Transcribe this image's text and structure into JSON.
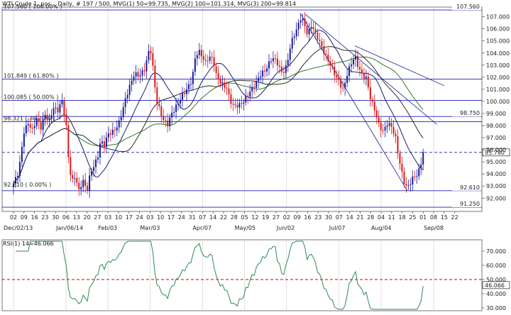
{
  "header": "WTI Crude 1. pos. , Daily, # 197 / 500, MVG(1) 50=99.735, MVG(2) 100=101.314, MVG(3) 200=99.814",
  "rsi_header": "RSI(1) 14=46.066",
  "chart_data": [
    {
      "type": "candlestick",
      "title": "WTI Crude 1. pos. , Daily",
      "ylim": [
        90.9,
        107.8
      ],
      "y_ticks": [
        92.0,
        93.0,
        94.0,
        95.0,
        96.0,
        97.0,
        98.0,
        99.0,
        100.0,
        101.0,
        102.0,
        103.0,
        104.0,
        105.0,
        106.0,
        107.0
      ],
      "x_day_labels": [
        "02",
        "09",
        "16",
        "23",
        "30",
        "06",
        "13",
        "20",
        "27",
        "03",
        "10",
        "17",
        "24",
        "03",
        "10",
        "17",
        "24",
        "31",
        "07",
        "14",
        "22",
        "28",
        "05",
        "12",
        "19",
        "27",
        "02",
        "09",
        "16",
        "23",
        "30",
        "07",
        "14",
        "21",
        "28",
        "04",
        "11",
        "18",
        "25",
        "01",
        "08",
        "15",
        "22"
      ],
      "x_month_labels": [
        {
          "index": 0,
          "label": "Dec/02/13"
        },
        {
          "index": 5,
          "label": "Jan/06/14"
        },
        {
          "index": 9,
          "label": "Feb/03"
        },
        {
          "index": 13,
          "label": "Mar/03"
        },
        {
          "index": 18,
          "label": "Apr/07"
        },
        {
          "index": 22,
          "label": "May/05"
        },
        {
          "index": 26,
          "label": "Jun/02"
        },
        {
          "index": 31,
          "label": "Jul/07"
        },
        {
          "index": 35,
          "label": "Aug/04"
        },
        {
          "index": 40,
          "label": "Sep/08"
        }
      ],
      "close_path": [
        [
          0,
          93.2
        ],
        [
          0.5,
          94.2
        ],
        [
          1,
          97.5
        ],
        [
          1.4,
          98.2
        ],
        [
          1.8,
          97.6
        ],
        [
          2.2,
          98.6
        ],
        [
          2.6,
          97.8
        ],
        [
          3,
          98.9
        ],
        [
          3.4,
          98.3
        ],
        [
          3.8,
          99.5
        ],
        [
          4.2,
          99.2
        ],
        [
          4.6,
          100.1
        ],
        [
          5,
          98.2
        ],
        [
          5.3,
          94.5
        ],
        [
          5.6,
          93.4
        ],
        [
          5.9,
          93.9
        ],
        [
          6.2,
          92.5
        ],
        [
          6.6,
          93.5
        ],
        [
          7,
          92.6
        ],
        [
          7.3,
          94.0
        ],
        [
          7.6,
          94.6
        ],
        [
          8,
          95.3
        ],
        [
          8.3,
          96.8
        ],
        [
          8.6,
          96.3
        ],
        [
          9,
          97.3
        ],
        [
          9.5,
          97.5
        ],
        [
          10,
          98.1
        ],
        [
          10.4,
          99.3
        ],
        [
          10.7,
          100.3
        ],
        [
          11,
          101.1
        ],
        [
          11.5,
          102.3
        ],
        [
          12,
          102.1
        ],
        [
          12.5,
          102.7
        ],
        [
          13,
          104.6
        ],
        [
          13.3,
          102.6
        ],
        [
          13.6,
          100.1
        ],
        [
          14,
          99.1
        ],
        [
          14.3,
          98.4
        ],
        [
          14.7,
          98.1
        ],
        [
          15,
          98.9
        ],
        [
          15.5,
          99.6
        ],
        [
          16,
          100.4
        ],
        [
          16.5,
          101.0
        ],
        [
          17,
          101.8
        ],
        [
          17.3,
          103.6
        ],
        [
          17.6,
          104.2
        ],
        [
          17.9,
          103.8
        ],
        [
          18.3,
          103.2
        ],
        [
          18.6,
          103.7
        ],
        [
          19,
          103.5
        ],
        [
          19.3,
          102.2
        ],
        [
          19.6,
          101.7
        ],
        [
          20,
          101.3
        ],
        [
          20.3,
          101.1
        ],
        [
          20.6,
          100.1
        ],
        [
          21,
          99.6
        ],
        [
          21.5,
          99.7
        ],
        [
          22,
          100.1
        ],
        [
          22.5,
          100.8
        ],
        [
          23,
          101.4
        ],
        [
          23.5,
          102.2
        ],
        [
          24,
          102.6
        ],
        [
          24.3,
          103.1
        ],
        [
          24.6,
          103.6
        ],
        [
          25,
          103.4
        ],
        [
          25.3,
          102.8
        ],
        [
          25.6,
          102.3
        ],
        [
          26,
          102.9
        ],
        [
          26.3,
          104.3
        ],
        [
          26.6,
          105.3
        ],
        [
          27,
          106.0
        ],
        [
          27.3,
          106.9
        ],
        [
          27.5,
          106.8
        ],
        [
          27.8,
          106.1
        ],
        [
          28,
          105.5
        ],
        [
          28.4,
          106.4
        ],
        [
          28.7,
          105.6
        ],
        [
          29,
          105.2
        ],
        [
          29.4,
          104.4
        ],
        [
          29.8,
          103.6
        ],
        [
          30.2,
          103.0
        ],
        [
          30.6,
          102.2
        ],
        [
          31,
          101.6
        ],
        [
          31.4,
          100.9
        ],
        [
          31.8,
          102.4
        ],
        [
          32.2,
          103.2
        ],
        [
          32.5,
          103.8
        ],
        [
          32.8,
          102.9
        ],
        [
          33.2,
          102.2
        ],
        [
          33.6,
          101.9
        ],
        [
          34,
          100.2
        ],
        [
          34.4,
          99.3
        ],
        [
          34.8,
          98.0
        ],
        [
          35.2,
          97.5
        ],
        [
          35.6,
          98.2
        ],
        [
          36,
          97.9
        ],
        [
          36.4,
          96.9
        ],
        [
          36.7,
          95.2
        ],
        [
          37,
          94.0
        ],
        [
          37.3,
          93.0
        ],
        [
          37.5,
          92.9
        ],
        [
          37.8,
          93.3
        ],
        [
          38.1,
          93.8
        ],
        [
          38.4,
          93.9
        ],
        [
          38.7,
          94.5
        ],
        [
          39,
          95.8
        ]
      ],
      "moving_averages": [
        {
          "name": "MVG(1) 50",
          "last": 99.735
        },
        {
          "name": "MVG(2) 100",
          "last": 101.314
        },
        {
          "name": "MVG(3) 200",
          "last": 99.814
        }
      ],
      "horizontal_levels": [
        {
          "value": 107.56,
          "label": "107.560",
          "side": "right"
        },
        {
          "value": 101.849,
          "label": "101.849 ( 61.80% )",
          "side": "left"
        },
        {
          "value": 100.085,
          "label": "100.085 ( 50.00% )",
          "side": "left"
        },
        {
          "value": 98.321,
          "label": "98.321 ( 38.20% )",
          "side": "left"
        },
        {
          "value": 98.75,
          "label": "98.750",
          "side": "right"
        },
        {
          "value": 92.61,
          "label": "92.610",
          "side": "right"
        },
        {
          "value": 91.25,
          "label": "91.250",
          "side": "right"
        }
      ],
      "fib_top_label": "107.560 ( 100.00% )",
      "fib_bottom_label": "92.610 ( 0.00% )",
      "last_price": 95.78,
      "last_price_label": "95.780",
      "dashed_level": 95.78
    },
    {
      "type": "line",
      "title": "RSI(1) 14=46.066",
      "ylim": [
        28,
        78
      ],
      "y_ticks": [
        30.0,
        40.0,
        50.0,
        60.0,
        70.0
      ],
      "reference_level": 50,
      "last_value": 46.066,
      "last_value_label": "46.066"
    }
  ],
  "colors": {
    "bull": "#1a1aa0",
    "bear": "#d81818",
    "ma50": "#1c1c6a",
    "ma100": "#2a2a2a",
    "ma200": "#2f7a2f",
    "fib": "#1c1cb4",
    "rsi": "#2d8a50",
    "ref": "#cc0000",
    "trend": "#3030a0"
  }
}
